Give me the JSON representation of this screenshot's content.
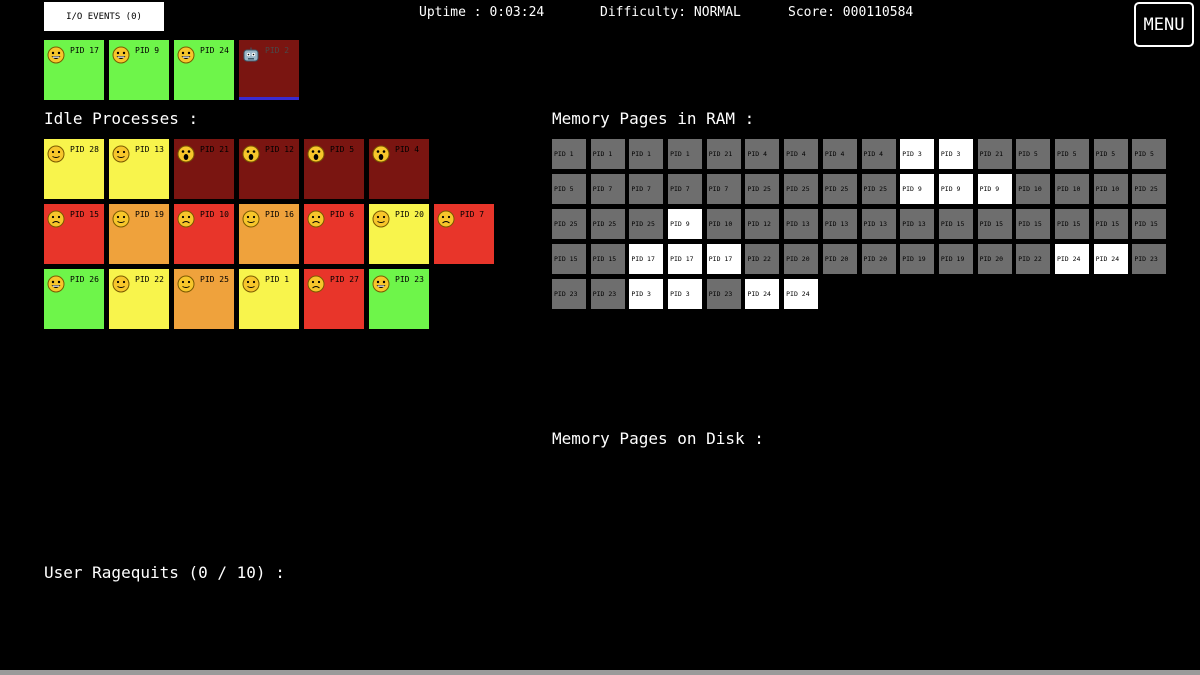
{
  "hud": {
    "io_events_label": "I/O EVENTS (0)",
    "uptime": "Uptime : 0:03:24",
    "difficulty": "Difficulty: NORMAL",
    "score": "Score: 000110584",
    "menu_label": "MENU"
  },
  "colors": {
    "green": "#6ef54a",
    "yellow": "#f8f44c",
    "orange": "#efa23c",
    "red": "#e8352a",
    "dark_red": "#7a1511",
    "page_ram": "#6e6e6e",
    "page_active": "#ffffff"
  },
  "cpu": {
    "processes": [
      {
        "pid": "PID 17",
        "state": "green",
        "face": "grin-face-icon"
      },
      {
        "pid": "PID 9",
        "state": "green",
        "face": "grin-face-icon"
      },
      {
        "pid": "PID 24",
        "state": "green",
        "face": "grin-face-icon"
      },
      {
        "pid": "PID 2",
        "state": "blocked",
        "face": "robot-face-icon",
        "progress": 1.0
      }
    ]
  },
  "idle": {
    "title": "Idle Processes :",
    "processes": [
      {
        "pid": "PID 28",
        "state": "yellow",
        "face": "neutral-face-icon"
      },
      {
        "pid": "PID 13",
        "state": "yellow",
        "face": "neutral-face-icon"
      },
      {
        "pid": "PID 21",
        "state": "dark_red",
        "face": "scream-face-icon"
      },
      {
        "pid": "PID 12",
        "state": "dark_red",
        "face": "scream-face-icon"
      },
      {
        "pid": "PID 5",
        "state": "dark_red",
        "face": "scream-face-icon"
      },
      {
        "pid": "PID 4",
        "state": "dark_red",
        "face": "scream-face-icon"
      },
      {
        "pid": "",
        "state": "empty",
        "face": ""
      },
      {
        "pid": "PID 15",
        "state": "red",
        "face": "sad-face-icon"
      },
      {
        "pid": "PID 19",
        "state": "orange",
        "face": "neutral-face-icon"
      },
      {
        "pid": "PID 10",
        "state": "red",
        "face": "sad-face-icon"
      },
      {
        "pid": "PID 16",
        "state": "orange",
        "face": "neutral-face-icon"
      },
      {
        "pid": "PID 6",
        "state": "red",
        "face": "sad-face-icon"
      },
      {
        "pid": "PID 20",
        "state": "yellow",
        "face": "neutral-face-icon"
      },
      {
        "pid": "PID 7",
        "state": "red",
        "face": "sad-face-icon"
      },
      {
        "pid": "PID 26",
        "state": "green",
        "face": "grin-face-icon"
      },
      {
        "pid": "PID 22",
        "state": "yellow",
        "face": "neutral-face-icon"
      },
      {
        "pid": "PID 25",
        "state": "orange",
        "face": "neutral-face-icon"
      },
      {
        "pid": "PID 1",
        "state": "yellow",
        "face": "neutral-face-icon"
      },
      {
        "pid": "PID 27",
        "state": "red",
        "face": "sad-face-icon"
      },
      {
        "pid": "PID 23",
        "state": "green",
        "face": "grin-face-icon"
      }
    ]
  },
  "ram": {
    "title": "Memory Pages in RAM :",
    "pages": [
      {
        "pid": "PID 1",
        "active": false
      },
      {
        "pid": "PID 1",
        "active": false
      },
      {
        "pid": "PID 1",
        "active": false
      },
      {
        "pid": "PID 1",
        "active": false
      },
      {
        "pid": "PID 21",
        "active": false
      },
      {
        "pid": "PID 4",
        "active": false
      },
      {
        "pid": "PID 4",
        "active": false
      },
      {
        "pid": "PID 4",
        "active": false
      },
      {
        "pid": "PID 4",
        "active": false
      },
      {
        "pid": "PID 3",
        "active": true
      },
      {
        "pid": "PID 3",
        "active": true
      },
      {
        "pid": "PID 21",
        "active": false
      },
      {
        "pid": "PID 5",
        "active": false
      },
      {
        "pid": "PID 5",
        "active": false
      },
      {
        "pid": "PID 5",
        "active": false
      },
      {
        "pid": "PID 5",
        "active": false
      },
      {
        "pid": "PID 5",
        "active": false
      },
      {
        "pid": "PID 7",
        "active": false
      },
      {
        "pid": "PID 7",
        "active": false
      },
      {
        "pid": "PID 7",
        "active": false
      },
      {
        "pid": "PID 7",
        "active": false
      },
      {
        "pid": "PID 25",
        "active": false
      },
      {
        "pid": "PID 25",
        "active": false
      },
      {
        "pid": "PID 25",
        "active": false
      },
      {
        "pid": "PID 25",
        "active": false
      },
      {
        "pid": "PID 9",
        "active": true
      },
      {
        "pid": "PID 9",
        "active": true
      },
      {
        "pid": "PID 9",
        "active": true
      },
      {
        "pid": "PID 10",
        "active": false
      },
      {
        "pid": "PID 10",
        "active": false
      },
      {
        "pid": "PID 10",
        "active": false
      },
      {
        "pid": "PID 25",
        "active": false
      },
      {
        "pid": "PID 25",
        "active": false
      },
      {
        "pid": "PID 25",
        "active": false
      },
      {
        "pid": "PID 25",
        "active": false
      },
      {
        "pid": "PID 9",
        "active": true
      },
      {
        "pid": "PID 10",
        "active": false
      },
      {
        "pid": "PID 12",
        "active": false
      },
      {
        "pid": "PID 13",
        "active": false
      },
      {
        "pid": "PID 13",
        "active": false
      },
      {
        "pid": "PID 13",
        "active": false
      },
      {
        "pid": "PID 13",
        "active": false
      },
      {
        "pid": "PID 15",
        "active": false
      },
      {
        "pid": "PID 15",
        "active": false
      },
      {
        "pid": "PID 15",
        "active": false
      },
      {
        "pid": "PID 15",
        "active": false
      },
      {
        "pid": "PID 15",
        "active": false
      },
      {
        "pid": "PID 15",
        "active": false
      },
      {
        "pid": "PID 15",
        "active": false
      },
      {
        "pid": "PID 15",
        "active": false
      },
      {
        "pid": "PID 17",
        "active": true
      },
      {
        "pid": "PID 17",
        "active": true
      },
      {
        "pid": "PID 17",
        "active": true
      },
      {
        "pid": "PID 22",
        "active": false
      },
      {
        "pid": "PID 20",
        "active": false
      },
      {
        "pid": "PID 20",
        "active": false
      },
      {
        "pid": "PID 20",
        "active": false
      },
      {
        "pid": "PID 19",
        "active": false
      },
      {
        "pid": "PID 19",
        "active": false
      },
      {
        "pid": "PID 20",
        "active": false
      },
      {
        "pid": "PID 22",
        "active": false
      },
      {
        "pid": "PID 24",
        "active": true
      },
      {
        "pid": "PID 24",
        "active": true
      },
      {
        "pid": "PID 23",
        "active": false
      },
      {
        "pid": "PID 23",
        "active": false
      },
      {
        "pid": "PID 23",
        "active": false
      },
      {
        "pid": "PID 3",
        "active": true
      },
      {
        "pid": "PID 3",
        "active": true
      },
      {
        "pid": "PID 23",
        "active": false
      },
      {
        "pid": "PID 24",
        "active": true
      },
      {
        "pid": "PID 24",
        "active": true
      }
    ]
  },
  "disk": {
    "title": "Memory Pages on Disk :"
  },
  "ragequits": {
    "title": "User Ragequits (0 / 10) :"
  }
}
